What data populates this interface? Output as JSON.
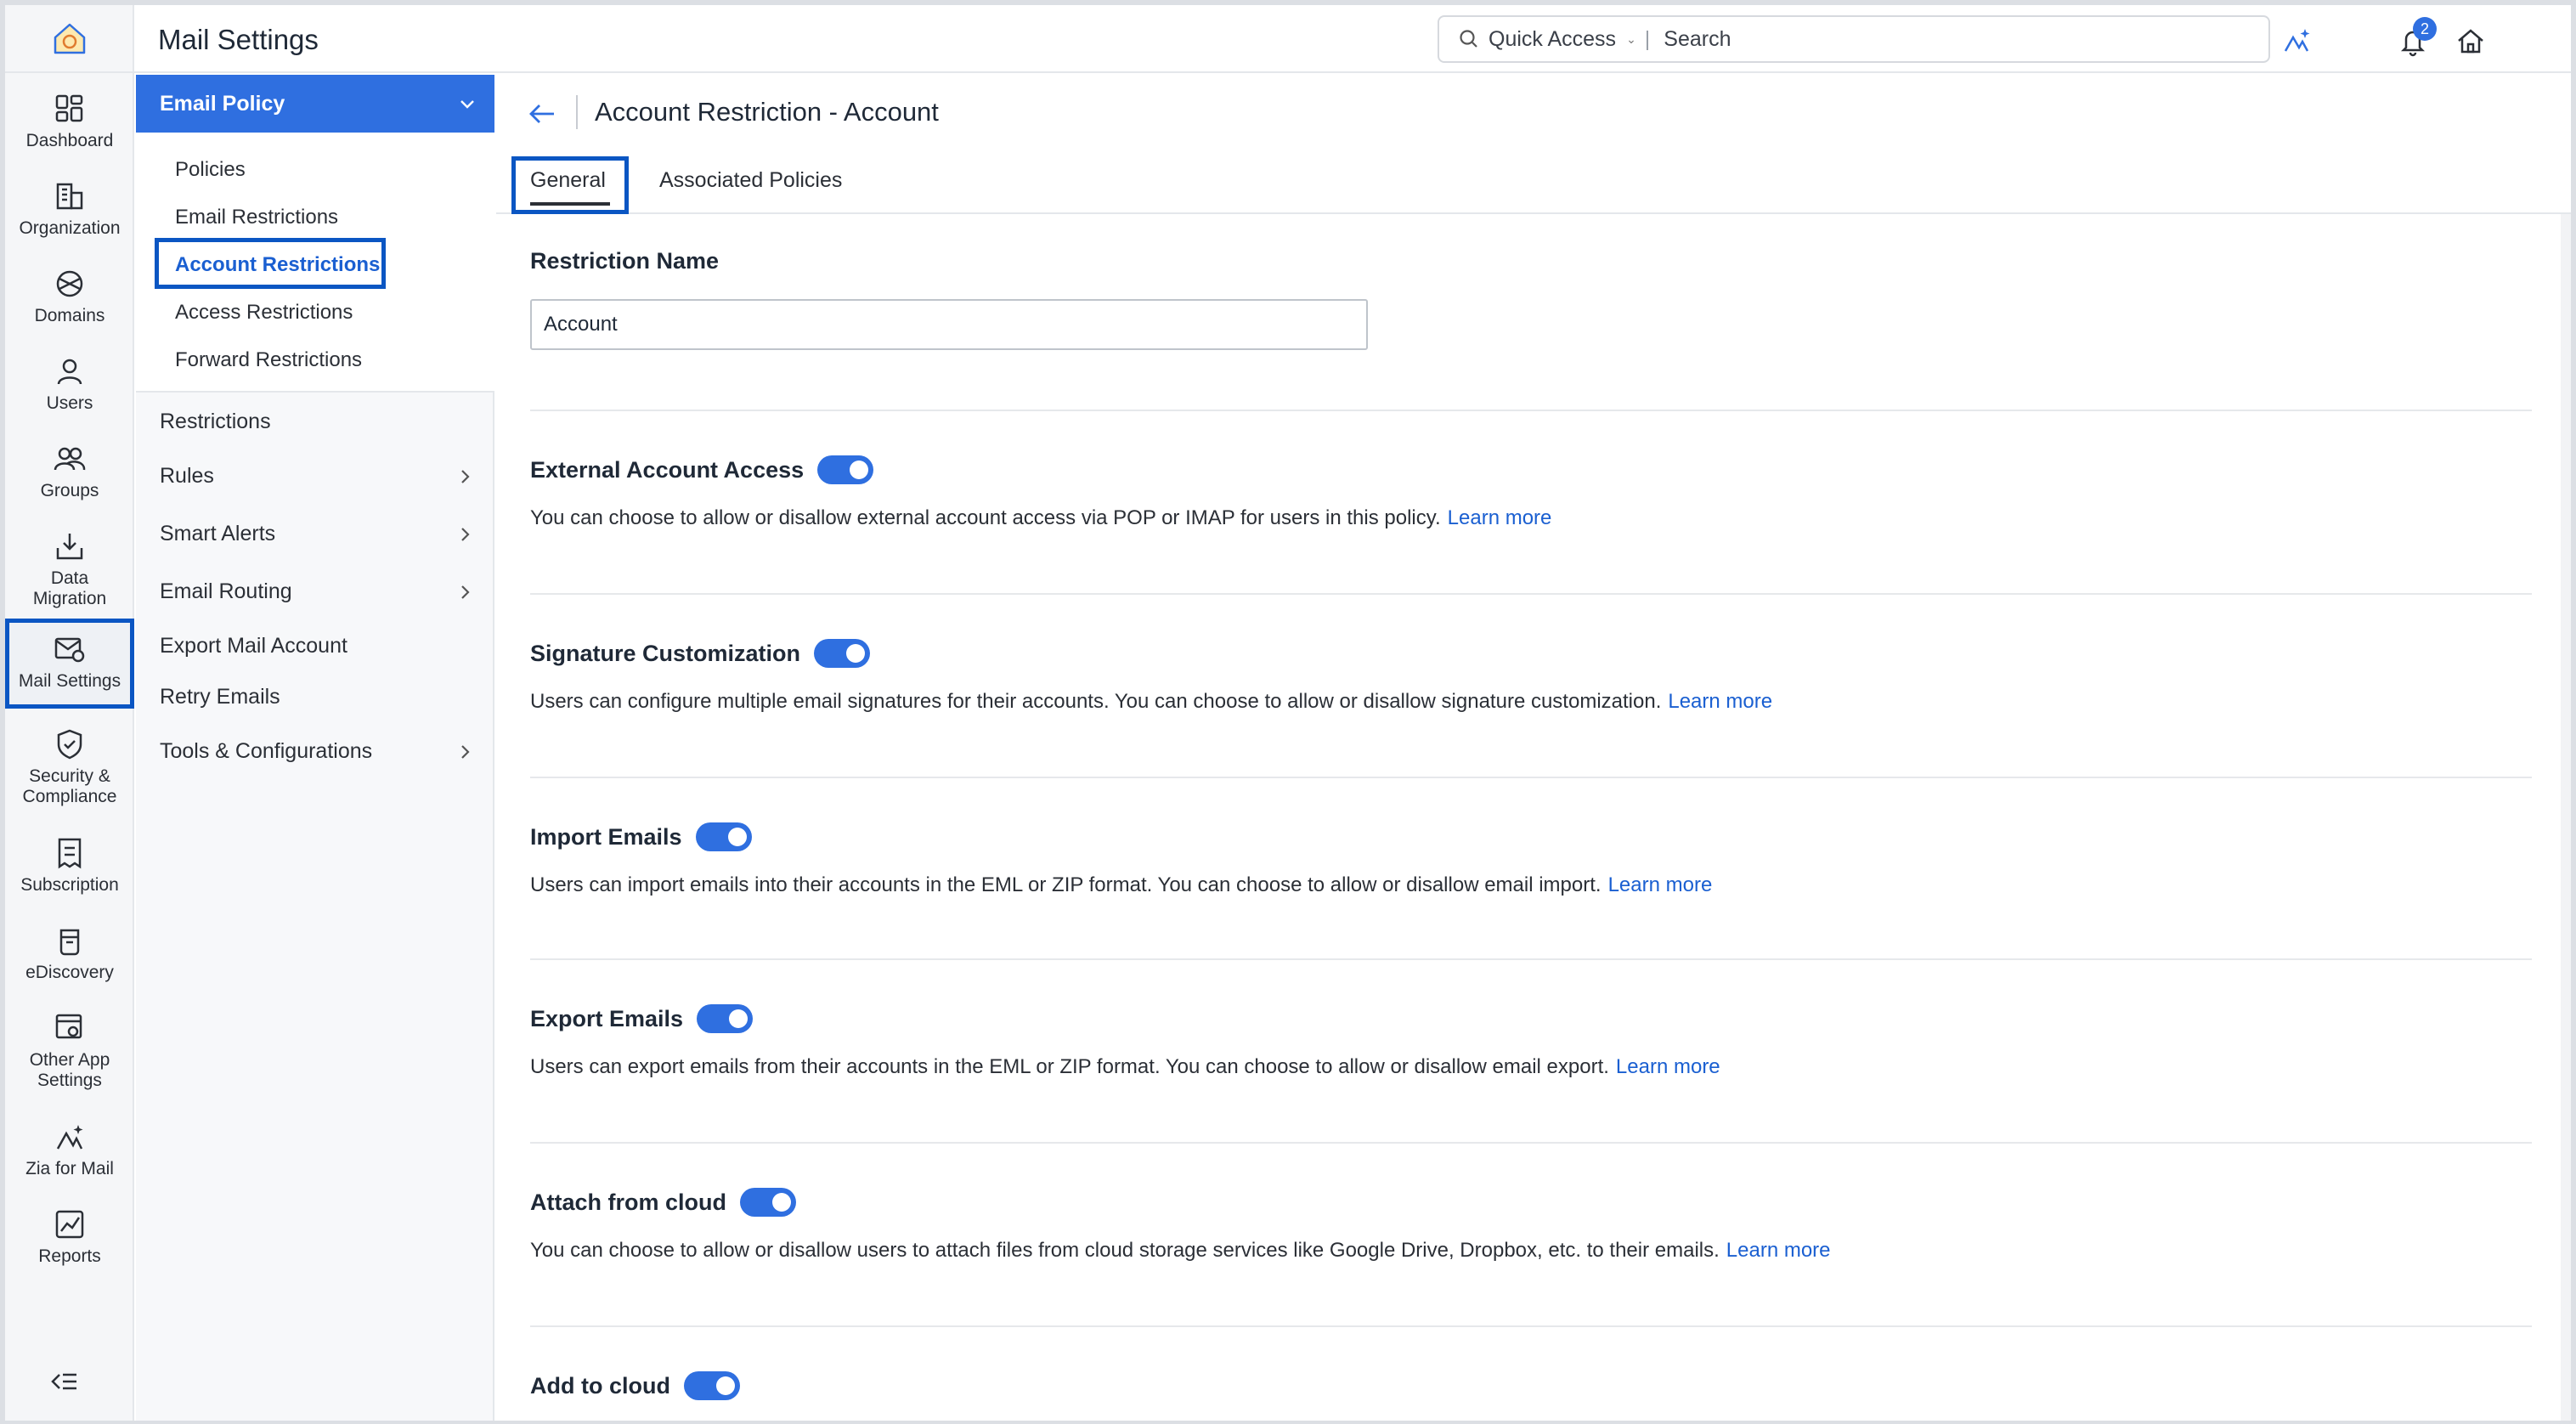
{
  "app": {
    "title": "Mail Settings"
  },
  "header": {
    "quick_access": "Quick Access",
    "search_placeholder": "Search",
    "notification_count": "2"
  },
  "rail": {
    "items": [
      {
        "label": "Dashboard"
      },
      {
        "label": "Organization"
      },
      {
        "label": "Domains"
      },
      {
        "label": "Users"
      },
      {
        "label": "Groups"
      },
      {
        "label": "Data Migration"
      },
      {
        "label": "Mail Settings"
      },
      {
        "label": "Security & Compliance"
      },
      {
        "label": "Subscription"
      },
      {
        "label": "eDiscovery"
      },
      {
        "label": "Other App Settings"
      },
      {
        "label": "Zia for Mail"
      },
      {
        "label": "Reports"
      }
    ]
  },
  "subnav": {
    "group_title": "Email Policy",
    "group_items": [
      "Policies",
      "Email Restrictions",
      "Account Restrictions",
      "Access Restrictions",
      "Forward Restrictions"
    ],
    "items": [
      "Restrictions",
      "Rules",
      "Smart Alerts",
      "Email Routing",
      "Export Mail Account",
      "Retry Emails",
      "Tools & Configurations"
    ]
  },
  "main": {
    "title": "Account Restriction - Account",
    "tabs": [
      "General",
      "Associated Policies"
    ],
    "restriction_name_label": "Restriction Name",
    "restriction_name_value": "Account",
    "learn_more": "Learn more",
    "sections": [
      {
        "title": "External Account Access",
        "desc": "You can choose to allow or disallow external account access via POP or IMAP for users in this policy."
      },
      {
        "title": "Signature Customization",
        "desc": "Users can configure multiple email signatures for their accounts. You can choose to allow or disallow signature customization."
      },
      {
        "title": "Import Emails",
        "desc": "Users can import emails into their accounts in the EML or ZIP format. You can choose to allow or disallow email import."
      },
      {
        "title": "Export Emails",
        "desc": "Users can export emails from their accounts in the EML or ZIP format. You can choose to allow or disallow email export."
      },
      {
        "title": "Attach from cloud",
        "desc": "You can choose to allow or disallow users to attach files from cloud storage services like Google Drive, Dropbox, etc. to their emails."
      },
      {
        "title": "Add to cloud",
        "desc": ""
      }
    ]
  }
}
